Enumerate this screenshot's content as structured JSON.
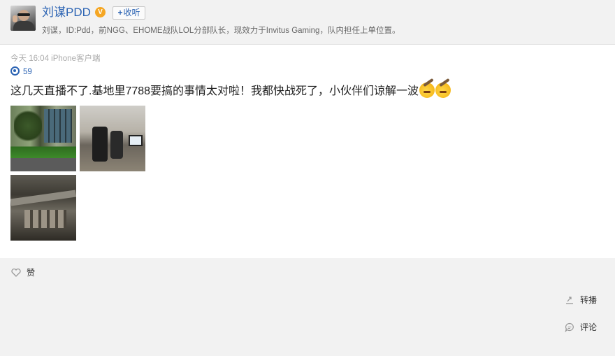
{
  "header": {
    "username": "刘谋PDD",
    "verified_badge": "V",
    "follow_label": "收听",
    "follow_plus": "+",
    "bio": "刘谋，ID:Pdd，前NGG、EHOME战队LOL分部队长，现效力于Invitus Gaming，队内担任上单位置。"
  },
  "post": {
    "timestamp": "今天 16:04 iPhone客户端",
    "repost_count": "59",
    "text": "这几天直播不了.基地里7788要搞的事情太对啦！我都快战死了，小伙伴们谅解一波",
    "emojis": [
      "sweat-emoji",
      "sweat-emoji"
    ],
    "photos": [
      "photo-courtyard",
      "photo-office",
      "photo-construction"
    ]
  },
  "actions": {
    "like_label": "赞",
    "repost_label": "转播",
    "comment_label": "评论"
  },
  "colors": {
    "link_blue": "#2b63b3",
    "verified_orange": "#f5a623",
    "band_gray": "#f2f2f2"
  }
}
